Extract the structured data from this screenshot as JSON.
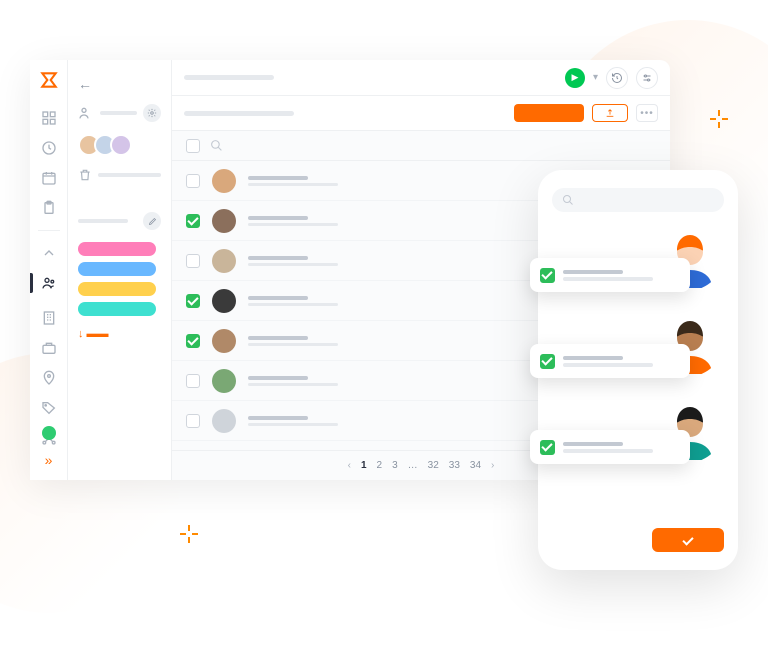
{
  "rail": {
    "items": [
      "logo",
      "dashboard",
      "clock",
      "calendar",
      "clipboard",
      "sep",
      "people",
      "building",
      "briefcase",
      "location",
      "tag",
      "structure"
    ]
  },
  "sidebar": {
    "avatars": [
      {
        "bg": "#e8c4a0"
      },
      {
        "bg": "#c4d4e8"
      },
      {
        "bg": "#d4c4e8"
      }
    ],
    "tags": [
      {
        "color": "#ff7eb9"
      },
      {
        "color": "#69b8ff"
      },
      {
        "color": "#ffd04d"
      },
      {
        "color": "#3ee0d0"
      }
    ]
  },
  "list": {
    "rows": [
      {
        "checked": false,
        "av": "#d9a87c"
      },
      {
        "checked": true,
        "av": "#8b6f5c"
      },
      {
        "checked": false,
        "av": "#c9b59a"
      },
      {
        "checked": true,
        "av": "#3a3a3a"
      },
      {
        "checked": true,
        "av": "#b08968"
      },
      {
        "checked": false,
        "av": "#7aa874"
      },
      {
        "checked": false,
        "av": "#cfd4da"
      }
    ]
  },
  "pagination": {
    "pages": [
      "1",
      "2",
      "3",
      "…",
      "32",
      "33",
      "34"
    ],
    "current": "1"
  },
  "phone": {
    "cards": [
      {
        "hair": "#ff6a00",
        "skin": "#fbd2b4",
        "shirt": "#2e6bd6"
      },
      {
        "hair": "#3b2a1a",
        "skin": "#b87e50",
        "shirt": "#ff6a00"
      },
      {
        "hair": "#1a1a1a",
        "skin": "#d9a87c",
        "shirt": "#0f9e91"
      }
    ]
  }
}
